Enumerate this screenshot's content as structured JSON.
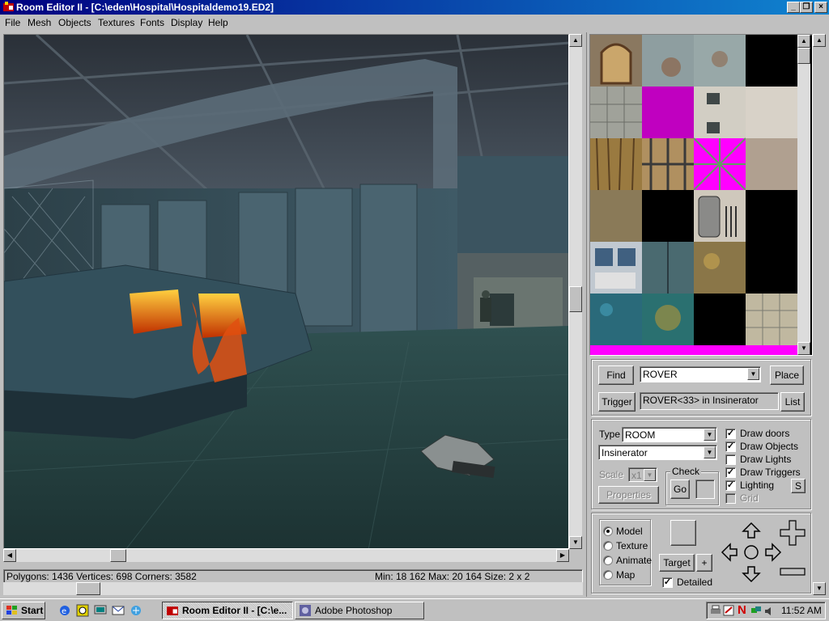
{
  "window": {
    "title": "Room Editor II - [C:\\eden\\Hospital\\Hospitaldemo19.ED2]"
  },
  "menu": [
    "File",
    "Mesh",
    "Objects",
    "Textures",
    "Fonts",
    "Display",
    "Help"
  ],
  "status": {
    "left": "Polygons: 1436  Vertices: 698  Corners: 3582",
    "right": "Min: 18 162  Max: 20 164  Size: 2 x 2"
  },
  "find": {
    "find_label": "Find",
    "object_value": "ROVER",
    "place_label": "Place",
    "trigger_label": "Trigger",
    "trigger_value": "ROVER<33> in Insinerator",
    "list_label": "List"
  },
  "props": {
    "type_label": "Type",
    "type_value": "ROOM",
    "room_value": "Insinerator",
    "scale_label": "Scale",
    "scale_value": "x1",
    "check_label": "Check",
    "go_label": "Go",
    "properties_label": "Properties",
    "s_label": "S",
    "checkboxes": [
      {
        "label": "Draw doors",
        "checked": true
      },
      {
        "label": "Draw Objects",
        "checked": true
      },
      {
        "label": "Draw Lights",
        "checked": false
      },
      {
        "label": "Draw Triggers",
        "checked": true
      },
      {
        "label": "Lighting",
        "checked": true
      },
      {
        "label": "Grid",
        "checked": false
      }
    ]
  },
  "mode": {
    "radios": [
      {
        "label": "Model",
        "selected": true
      },
      {
        "label": "Texture",
        "selected": false
      },
      {
        "label": "Animate",
        "selected": false
      },
      {
        "label": "Map",
        "selected": false
      }
    ],
    "target_label": "Target",
    "plus_label": "+",
    "detailed_label": "Detailed"
  },
  "taskbar": {
    "start_label": "Start",
    "tasks": [
      "Room Editor II - [C:\\e...",
      "Adobe Photoshop"
    ],
    "clock": "11:52 AM"
  }
}
